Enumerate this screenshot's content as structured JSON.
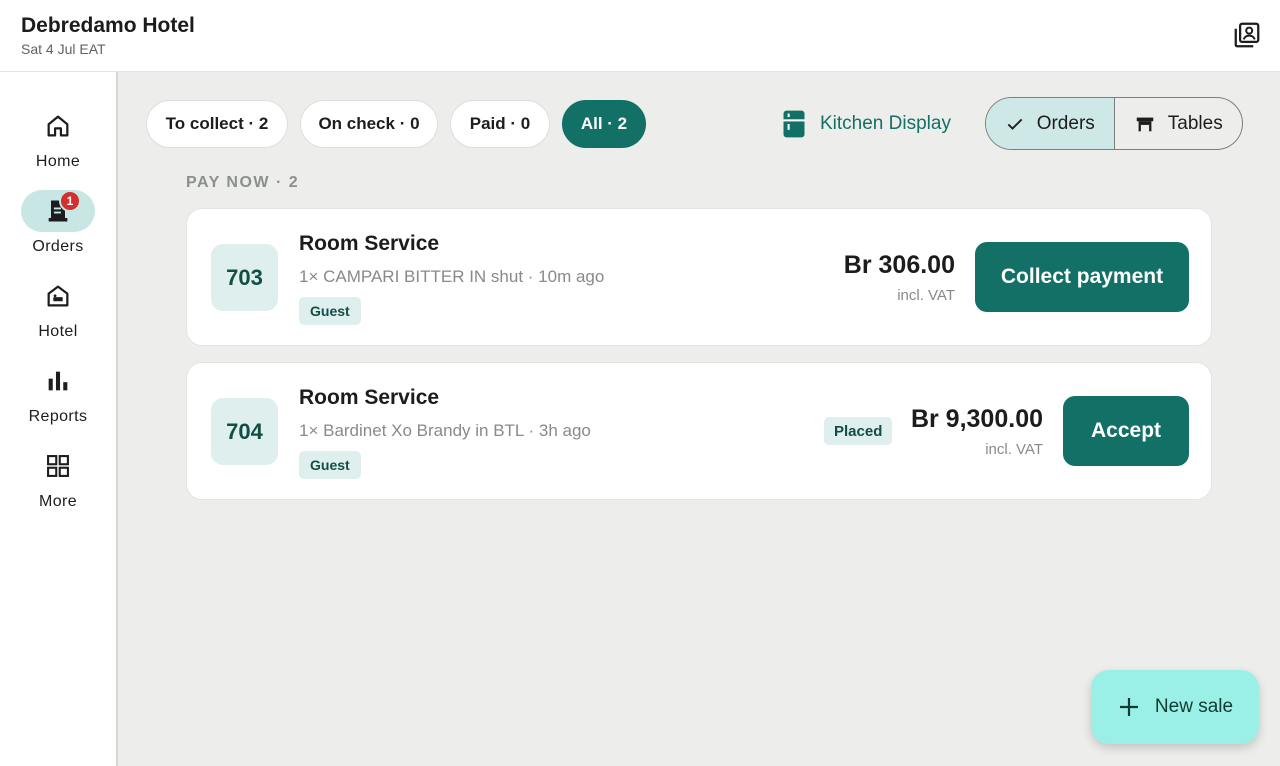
{
  "header": {
    "title": "Debredamo Hotel",
    "date": "Sat 4 Jul EAT",
    "profile_icon": "account-box-icon"
  },
  "sidebar": {
    "items": [
      {
        "label": "Home",
        "icon": "home-icon",
        "active": false
      },
      {
        "label": "Orders",
        "icon": "orders-icon",
        "active": true,
        "badge": "1"
      },
      {
        "label": "Hotel",
        "icon": "hotel-icon",
        "active": false
      },
      {
        "label": "Reports",
        "icon": "bar-chart-icon",
        "active": false
      },
      {
        "label": "More",
        "icon": "grid-icon",
        "active": false
      }
    ]
  },
  "filters": [
    {
      "label": "To collect · 2",
      "active": false
    },
    {
      "label": "On check · 0",
      "active": false
    },
    {
      "label": "Paid · 0",
      "active": false
    },
    {
      "label": "All · 2",
      "active": true
    }
  ],
  "kitchen_display": {
    "label": "Kitchen Display",
    "icon": "kitchen-icon"
  },
  "view_toggle": {
    "orders_label": "Orders",
    "tables_label": "Tables",
    "selected": "Orders"
  },
  "section": {
    "title": "PAY NOW · 2"
  },
  "orders": [
    {
      "room": "703",
      "title": "Room Service",
      "description": "1× CAMPARI BITTER IN shut · 10m ago",
      "tag": "Guest",
      "status": "",
      "price": "Br 306.00",
      "vat_note": "incl. VAT",
      "action": "Collect payment"
    },
    {
      "room": "704",
      "title": "Room Service",
      "description": "1× Bardinet Xo Brandy in BTL · 3h ago",
      "tag": "Guest",
      "status": "Placed",
      "price": "Br 9,300.00",
      "vat_note": "incl. VAT",
      "action": "Accept"
    }
  ],
  "fab": {
    "label": "New sale",
    "icon": "plus-icon"
  },
  "colors": {
    "accent": "#127066",
    "accent_light": "#deefed",
    "fab": "#9af0e6",
    "badge": "#d32f2f",
    "background": "#edeeeb"
  }
}
